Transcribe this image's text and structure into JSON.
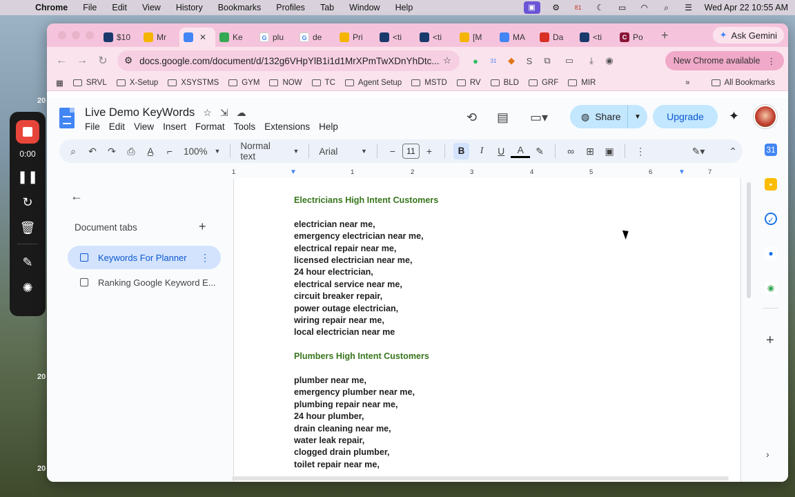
{
  "menubar": {
    "app": "Chrome",
    "items": [
      "File",
      "Edit",
      "View",
      "History",
      "Bookmarks",
      "Profiles",
      "Tab",
      "Window",
      "Help"
    ],
    "datetime": "Wed Apr 22  10:55 AM",
    "badge_number": "81"
  },
  "recorder": {
    "time": "0:00"
  },
  "desktop_edge": {
    "left_labels": [
      "20",
      "20",
      "20"
    ]
  },
  "browser": {
    "tabs": [
      {
        "label": "$10",
        "color": "#1a3a6b"
      },
      {
        "label": "Mr",
        "color": "#f4b400"
      },
      {
        "label": "",
        "color": "#4285f4",
        "active": true
      },
      {
        "label": "Ke",
        "color": "#34a853"
      },
      {
        "label": "plu",
        "color": "#ea4335"
      },
      {
        "label": "de",
        "color": "#ea4335"
      },
      {
        "label": "Pri",
        "color": "#f4b400"
      },
      {
        "label": "<ti",
        "color": "#1a3a6b"
      },
      {
        "label": "<ti",
        "color": "#1a3a6b"
      },
      {
        "label": "[M",
        "color": "#f4b400"
      },
      {
        "label": "MA",
        "color": "#4285f4"
      },
      {
        "label": "Da",
        "color": "#d93025"
      },
      {
        "label": "<ti",
        "color": "#1a3a6b"
      },
      {
        "label": "Po",
        "color": "#8a1538"
      }
    ],
    "ask_gemini": "Ask Gemini",
    "url": "docs.google.com/document/d/132g6VHpYlB1i1d1MrXPmTwXDnYhDtc...",
    "new_chrome": "New Chrome available",
    "ext_badge": "31",
    "bookmarks": [
      "SRVL",
      "X-Setup",
      "XSYSTMS",
      "GYM",
      "NOW",
      "TC",
      "Agent Setup",
      "MSTD",
      "RV",
      "BLD",
      "GRF",
      "MIR"
    ],
    "all_bookmarks": "All Bookmarks"
  },
  "docs": {
    "title": "Live Demo KeyWords",
    "menu": [
      "File",
      "Edit",
      "View",
      "Insert",
      "Format",
      "Tools",
      "Extensions",
      "Help"
    ],
    "share": "Share",
    "upgrade": "Upgrade",
    "toolbar": {
      "zoom": "100%",
      "style": "Normal text",
      "font": "Arial",
      "font_size": "11"
    },
    "ruler": [
      "1",
      "1",
      "2",
      "3",
      "4",
      "5",
      "6",
      "7"
    ],
    "tabs_heading": "Document tabs",
    "doc_tabs": [
      "Keywords For Planner",
      "Ranking Google Keyword E..."
    ],
    "content": {
      "section1_heading": "Electricians High Intent Customers",
      "section1_lines": [
        "electrician near me,",
        "emergency electrician near me,",
        "electrical repair near me,",
        "licensed electrician near me,",
        "24 hour electrician,",
        "electrical service near me,",
        "circuit breaker repair,",
        "power outage electrician,",
        "wiring repair near me,",
        "local electrician near me"
      ],
      "section2_heading": "Plumbers High Intent Customers",
      "section2_lines": [
        "plumber near me,",
        "emergency plumber near me,",
        "plumbing repair near me,",
        "24 hour plumber,",
        "drain cleaning near me,",
        "water leak repair,",
        "clogged drain plumber,",
        "toilet repair near me,"
      ]
    }
  }
}
